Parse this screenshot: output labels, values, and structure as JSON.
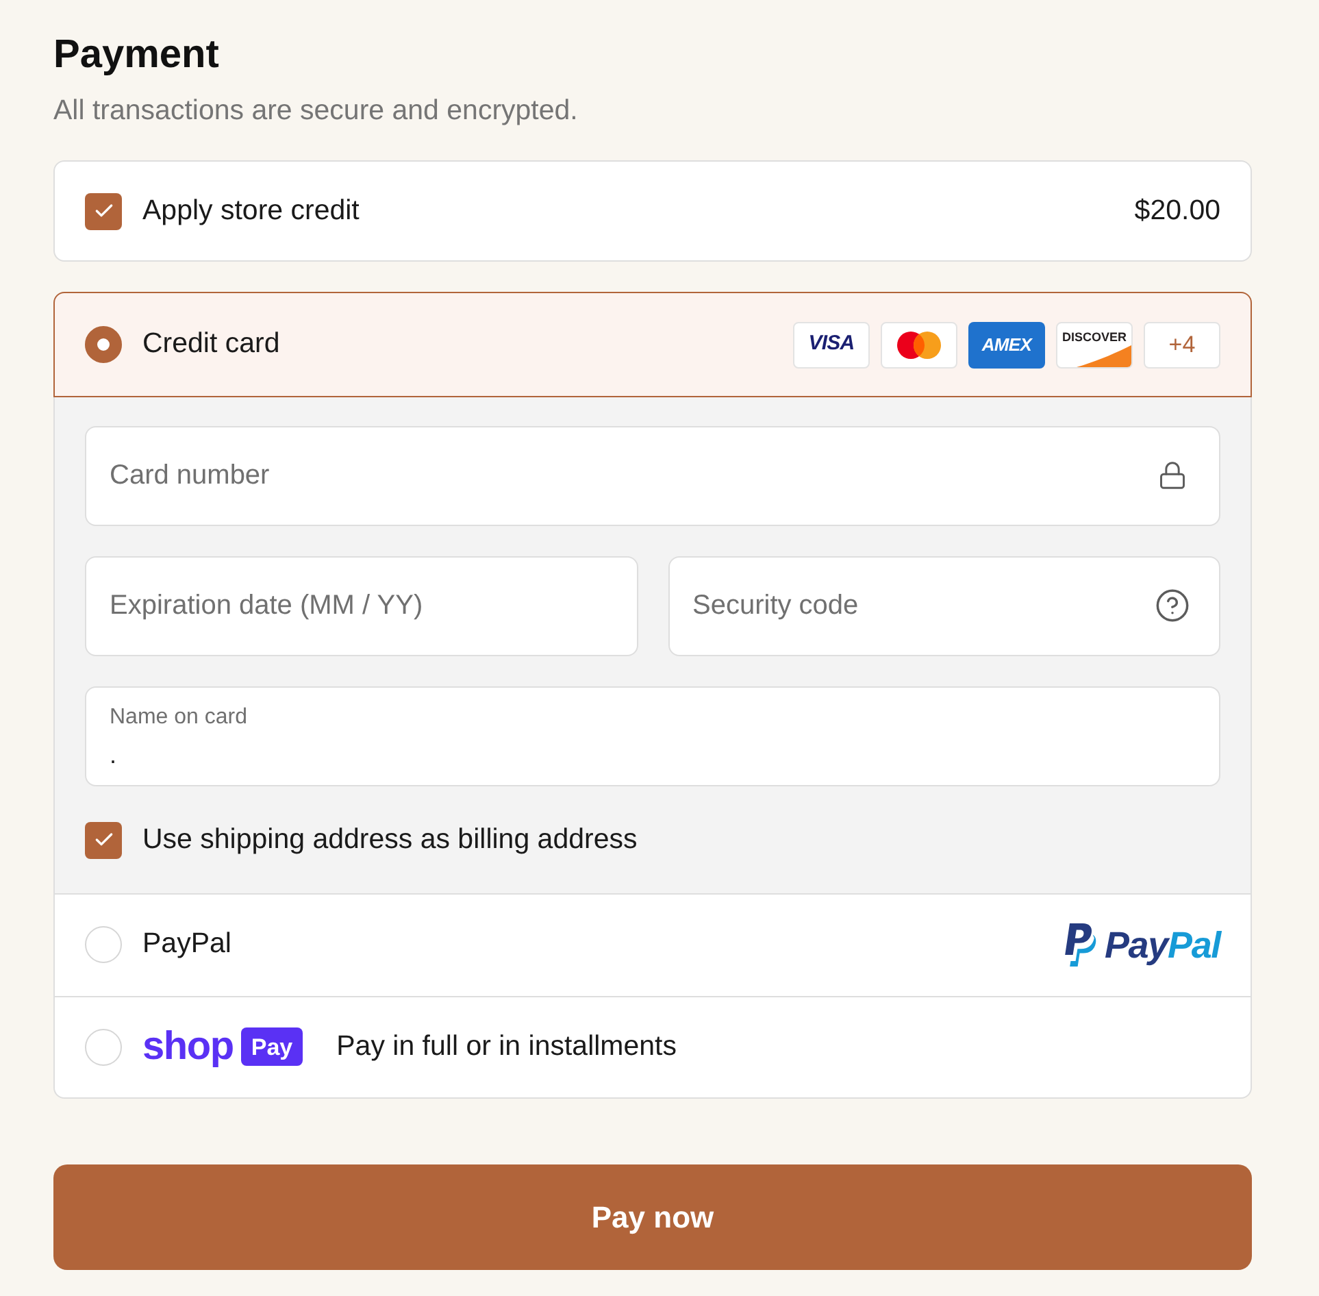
{
  "header": {
    "title": "Payment",
    "subtitle": "All transactions are secure and encrypted."
  },
  "store_credit": {
    "label": "Apply store credit",
    "checked": true,
    "amount": "$20.00"
  },
  "payment_methods": [
    {
      "kind": "card",
      "label": "Credit card",
      "selected": true,
      "brands": [
        {
          "kind": "visa",
          "text": "VISA"
        },
        {
          "kind": "mastercard"
        },
        {
          "kind": "amex",
          "text": "AMEX"
        },
        {
          "kind": "discover",
          "text": "DISCOVER"
        },
        {
          "kind": "more",
          "text": "+4"
        }
      ],
      "form": {
        "card_number": {
          "placeholder": "Card number"
        },
        "expiration": {
          "placeholder": "Expiration date (MM / YY)"
        },
        "security_code": {
          "placeholder": "Security code"
        },
        "name_on_card": {
          "label": "Name on card",
          "value": "."
        },
        "billing_same_as_shipping": {
          "label": "Use shipping address as billing address",
          "checked": true
        }
      }
    },
    {
      "kind": "paypal",
      "label": "PayPal",
      "selected": false,
      "wordmark": [
        {
          "text": "Pay",
          "color": "#253b80"
        },
        {
          "text": "Pal",
          "color": "#179bd7"
        }
      ]
    },
    {
      "kind": "shop_pay",
      "selected": false,
      "logo": {
        "word": "shop",
        "badge": "Pay"
      },
      "label": "Pay in full or in installments"
    }
  ],
  "pay_button": {
    "label": "Pay now"
  }
}
